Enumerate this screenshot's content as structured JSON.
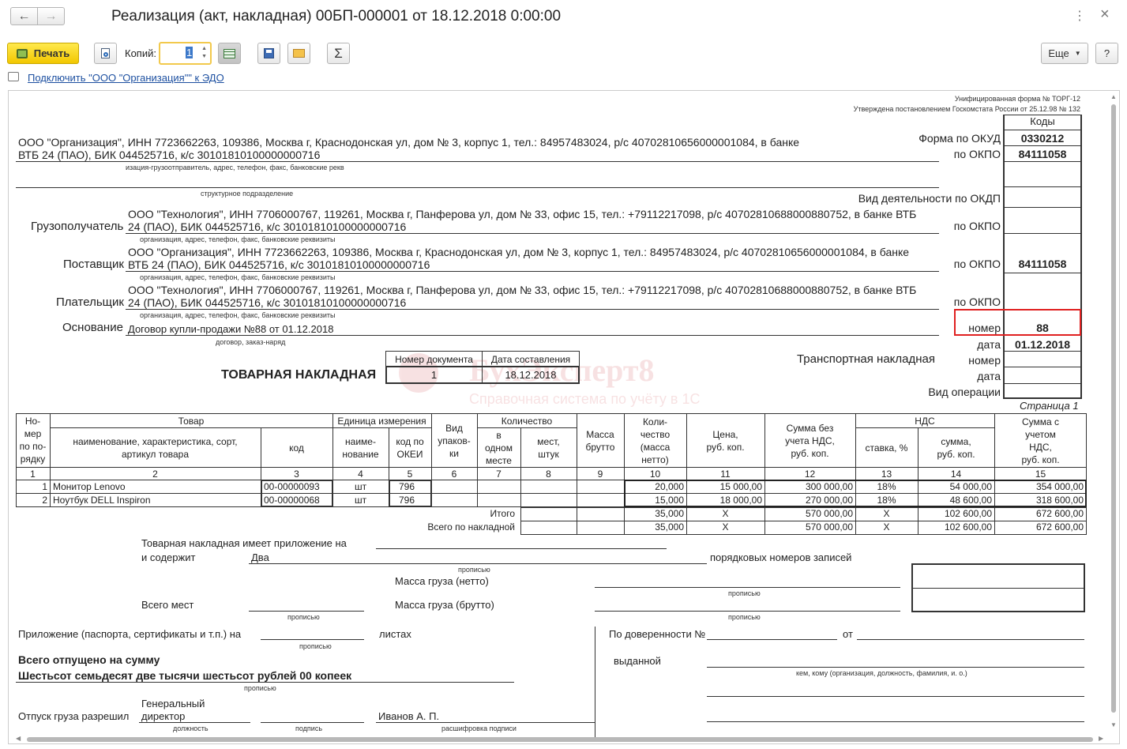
{
  "window": {
    "title": "Реализация (акт, накладная) 00БП-000001 от 18.12.2018 0:00:00"
  },
  "toolbar": {
    "print": "Печать",
    "copies_label": "Копий:",
    "copies_value": "1",
    "more": "Еще",
    "help": "?"
  },
  "edo_link": "Подключить \"ООО \"Организация\"\" к ЭДО",
  "doc": {
    "form_title": "Унифицированная форма № ТОРГ-12",
    "form_approved": "Утверждена постановлением Госкомстата России от 25.12.98 № 132",
    "codes_header": "Коды",
    "okud_label": "Форма по ОКУД",
    "okud": "0330212",
    "okpo_label": "по ОКПО",
    "okpo1": "84111058",
    "okdp_label": "Вид деятельности по ОКДП",
    "okpo2_label": "по ОКПО",
    "okpo3_label": "по ОКПО",
    "okpo3": "84111058",
    "okpo4_label": "по ОКПО",
    "nomer_label": "номер",
    "nomer": "88",
    "data_label": "дата",
    "data": "01.12.2018",
    "transport_label": "Транспортная накладная",
    "t_nomer_label": "номер",
    "t_data_label": "дата",
    "vid_op_label": "Вид операции",
    "org_line1": "ООО \"Организация\", ИНН 7723662263, 109386, Москва г, Краснодонская ул, дом № 3, корпус 1, тел.: 84957483024, р/с 40702810656000001084, в банке",
    "org_line2": "ВТБ 24 (ПАО), БИК 044525716, к/с 30101810100000000716",
    "org_caption": "изация-грузоотправитель, адрес, телефон, факс, банковские рекв",
    "struct_caption": "структурное подразделение",
    "consignee_label": "Грузополучатель",
    "consignee_line1": "ООО \"Технология\", ИНН 7706000767, 119261, Москва г, Панферова ул, дом № 33, офис 15, тел.: +79112217098, р/с 40702810688000880752, в банке ВТБ",
    "consignee_line2": "24 (ПАО), БИК 044525716, к/с 30101810100000000716",
    "req_caption": "организация, адрес, телефон, факс, банковские реквизиты",
    "supplier_label": "Поставщик",
    "supplier_line1": "ООО \"Организация\", ИНН 7723662263, 109386, Москва г, Краснодонская ул, дом № 3, корпус 1, тел.: 84957483024, р/с 40702810656000001084, в банке",
    "supplier_line2": "ВТБ 24 (ПАО), БИК 044525716, к/с 30101810100000000716",
    "payer_label": "Плательщик",
    "payer_line1": "ООО \"Технология\", ИНН 7706000767, 119261, Москва г, Панферова ул, дом № 33, офис 15, тел.: +79112217098, р/с 40702810688000880752, в банке ВТБ",
    "payer_line2": "24 (ПАО), БИК 044525716, к/с 30101810100000000716",
    "basis_label": "Основание",
    "basis": "Договор купли-продажи №88 от 01.12.2018",
    "basis_caption": "договор, заказ-наряд",
    "doc_title": "ТОВАРНАЯ НАКЛАДНАЯ",
    "doc_num_header": "Номер документа",
    "doc_date_header": "Дата составления",
    "doc_num": "1",
    "doc_date": "18.12.2018",
    "page": "Страница 1",
    "watermark_brand": "БухЭксперт8",
    "watermark_sub": "Справочная система по учёту в 1С"
  },
  "table": {
    "h_no": [
      "Но-",
      "мер",
      "по по-",
      "рядку"
    ],
    "h_goods": "Товар",
    "h_goods_name": [
      "наименование, характеристика, сорт,",
      "артикул товара"
    ],
    "h_code": "код",
    "h_unit": "Единица измерения",
    "h_unit_name": [
      "наиме-",
      "нование"
    ],
    "h_okei": [
      "код по",
      "ОКЕИ"
    ],
    "h_pack": [
      "Вид",
      "упаков-",
      "ки"
    ],
    "h_qty": "Количество",
    "h_in_one": [
      "в",
      "одном",
      "месте"
    ],
    "h_places": [
      "мест,",
      "штук"
    ],
    "h_gross": [
      "Масса",
      "брутто"
    ],
    "h_net": [
      "Коли-",
      "чество",
      "(масса",
      "нетто)"
    ],
    "h_price": [
      "Цена,",
      "руб. коп."
    ],
    "h_sum_wo": [
      "Сумма без",
      "учета НДС,",
      "руб. коп."
    ],
    "h_vat": "НДС",
    "h_rate": "ставка, %",
    "h_vat_sum": [
      "сумма,",
      "руб. коп."
    ],
    "h_sum_with": [
      "Сумма с",
      "учетом",
      "НДС,",
      "руб. коп."
    ],
    "col_nums": [
      "1",
      "2",
      "3",
      "4",
      "5",
      "6",
      "7",
      "8",
      "9",
      "10",
      "11",
      "12",
      "13",
      "14",
      "15"
    ],
    "rows": [
      {
        "n": "1",
        "name": "Монитор Lenovo",
        "code": "00-00000093",
        "unit": "шт",
        "okei": "796",
        "qty": "20,000",
        "price": "15 000,00",
        "sum": "300 000,00",
        "rate": "18%",
        "vat": "54 000,00",
        "total": "354 000,00"
      },
      {
        "n": "2",
        "name": "Ноутбук DELL Inspiron",
        "code": "00-00000068",
        "unit": "шт",
        "okei": "796",
        "qty": "15,000",
        "price": "18 000,00",
        "sum": "270 000,00",
        "rate": "18%",
        "vat": "48 600,00",
        "total": "318 600,00"
      }
    ],
    "itogo_label": "Итого",
    "itogo": {
      "qty": "35,000",
      "price": "X",
      "sum": "570 000,00",
      "rate": "X",
      "vat": "102 600,00",
      "total": "672 600,00"
    },
    "vsego_label": "Всего по накладной",
    "vsego": {
      "qty": "35,000",
      "price": "X",
      "sum": "570 000,00",
      "rate": "X",
      "vat": "102 600,00",
      "total": "672 600,00"
    }
  },
  "footer": {
    "attach_line1": "Товарная накладная имеет приложение на",
    "attach_line2": "и содержит",
    "attach_value": "Два",
    "records": "порядковых номеров записей",
    "propisyu": "прописью",
    "net_label": "Масса груза (нетто)",
    "gross_label": "Масса груза (брутто)",
    "places_label": "Всего мест",
    "app_label": "Приложение (паспорта, сертификаты и т.п.) на",
    "sheets": "листах",
    "total_label": "Всего отпущено  на сумму",
    "total_words": "Шестьсот семьдесят две тысячи шестьсот рублей 00 копеек",
    "release_label": "Отпуск груза разрешил",
    "position": "Генеральный директор",
    "position1": "Генеральный",
    "position2": "директор",
    "name": "Иванов А. П.",
    "cap_position": "должность",
    "cap_signature": "подпись",
    "cap_decode": "расшифровка подписи",
    "proxy_label": "По доверенности №",
    "from_label": "от",
    "issued_label": "выданной",
    "issued_caption": "кем, кому (организация, должность, фамилия, и. о.)"
  }
}
